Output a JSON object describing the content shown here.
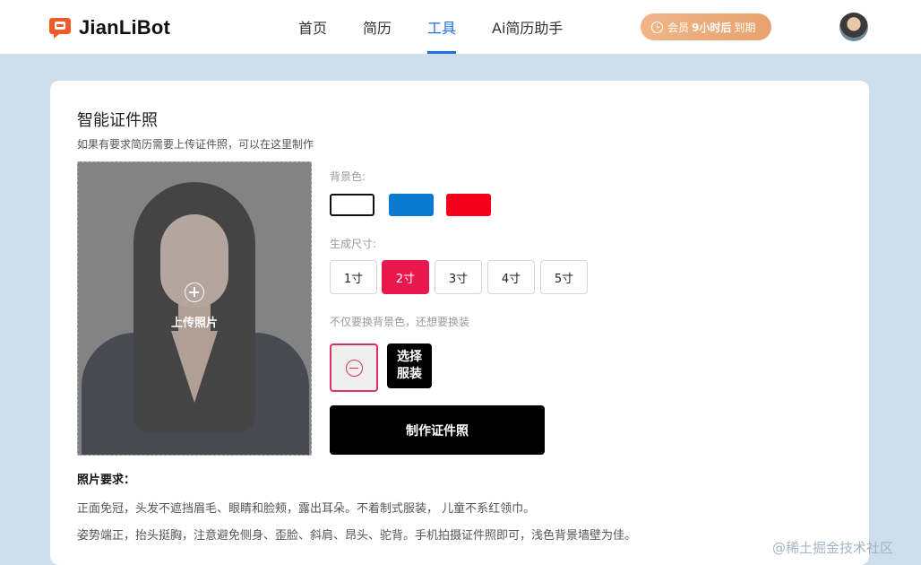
{
  "header": {
    "logo_text": "JianLiBot",
    "nav": [
      {
        "label": "首页",
        "active": false
      },
      {
        "label": "简历",
        "active": false
      },
      {
        "label": "工具",
        "active": true
      },
      {
        "label": "Ai简历助手",
        "active": false
      }
    ],
    "member": {
      "prefix": "会员",
      "time": "9小时后",
      "suffix": "到期"
    }
  },
  "card": {
    "title": "智能证件照",
    "subtitle": "如果有要求简历需要上传证件照，可以在这里制作",
    "upload_label": "上传照片",
    "bg_label": "背景色:",
    "bg_colors": [
      {
        "name": "white",
        "hex": "#ffffff",
        "selected": true
      },
      {
        "name": "blue",
        "hex": "#0a7ad0",
        "selected": false
      },
      {
        "name": "red",
        "hex": "#f5001a",
        "selected": false
      }
    ],
    "size_label": "生成尺寸:",
    "sizes": [
      {
        "label": "1寸",
        "active": false
      },
      {
        "label": "2寸",
        "active": true
      },
      {
        "label": "3寸",
        "active": false
      },
      {
        "label": "4寸",
        "active": false
      },
      {
        "label": "5寸",
        "active": false
      }
    ],
    "outfit_label": "不仅要换背景色，还想要换装",
    "outfit_select_label": "选择服装",
    "make_button": "制作证件照",
    "requirements_title": "照片要求：",
    "requirements": [
      "正面免冠，头发不遮挡眉毛、眼睛和脸颊，露出耳朵。不着制式服装， 儿童不系红领巾。",
      "姿势端正，抬头挺胸，注意避免侧身、歪脸、斜肩、昂头、驼背。手机拍摄证件照即可，浅色背景墙壁为佳。"
    ]
  },
  "watermark": "@稀土掘金技术社区",
  "colors": {
    "accent": "#1f6fe0",
    "active_size": "#e8184f",
    "logo": "#f05a28"
  }
}
